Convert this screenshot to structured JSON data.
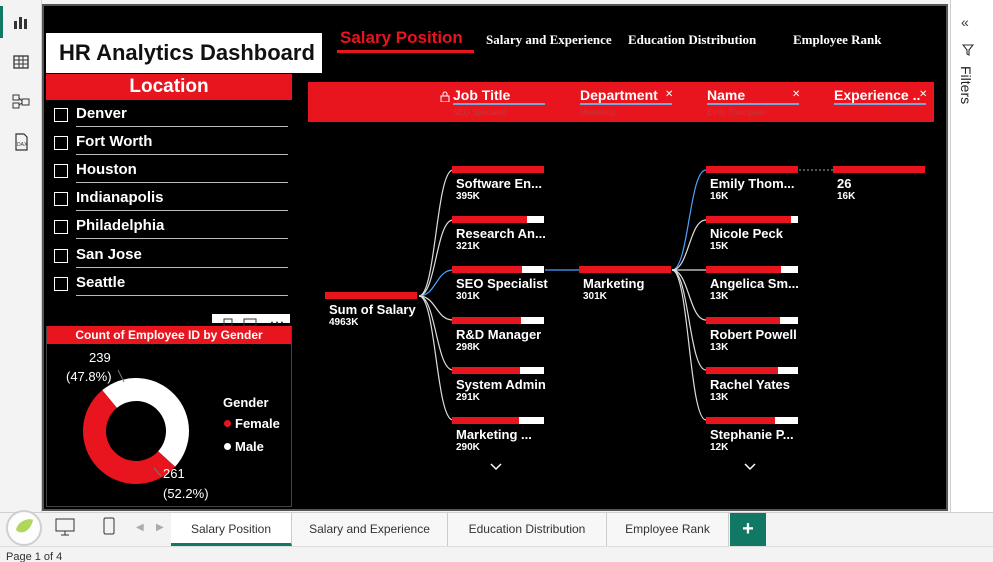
{
  "dashboard": {
    "title": "HR Analytics Dashboard",
    "nav": {
      "active": "Salary Position",
      "items": [
        "Salary and Experience",
        "Education Distribution",
        "Employee Rank"
      ]
    }
  },
  "location_slicer": {
    "title": "Location",
    "items": [
      "Denver",
      "Fort Worth",
      "Houston",
      "Indianapolis",
      "Philadelphia",
      "San Jose",
      "Seattle"
    ]
  },
  "gender_chart": {
    "title": "Count of Employee ID by Gender",
    "legend_title": "Gender",
    "legend": [
      "Female",
      "Male"
    ],
    "label_male": "239",
    "label_male_pct": "(47.8%)",
    "label_female": "261",
    "label_female_pct": "(52.2%)"
  },
  "chart_data": {
    "type": "pie",
    "title": "Count of Employee ID by Gender",
    "categories": [
      "Female",
      "Male"
    ],
    "values": [
      261,
      239
    ],
    "percentages": [
      52.2,
      47.8
    ],
    "donut": true,
    "legend_placement": "right",
    "colors": {
      "Female": "#e8141e",
      "Male": "#ffffff"
    }
  },
  "tree": {
    "levels": [
      {
        "title": "Job Title",
        "sub": "SEO Specialist",
        "lock": true
      },
      {
        "title": "Department",
        "sub": "Marketing"
      },
      {
        "title": "Name",
        "sub": "Emily Thompson"
      },
      {
        "title": "Experience ...",
        "sub": ""
      }
    ],
    "root": {
      "label": "Sum of Salary",
      "value": "4963K"
    },
    "job_titles": [
      {
        "label": "Software En...",
        "value": "395K",
        "fill": 1.0
      },
      {
        "label": "Research An...",
        "value": "321K",
        "fill": 0.81
      },
      {
        "label": "SEO Specialist",
        "value": "301K",
        "fill": 0.76
      },
      {
        "label": "R&D Manager",
        "value": "298K",
        "fill": 0.75
      },
      {
        "label": "System Admin",
        "value": "291K",
        "fill": 0.74
      },
      {
        "label": "Marketing ...",
        "value": "290K",
        "fill": 0.73
      }
    ],
    "departments": [
      {
        "label": "Marketing",
        "value": "301K",
        "fill": 1.0
      }
    ],
    "names": [
      {
        "label": "Emily Thom...",
        "value": "16K",
        "fill": 1.0
      },
      {
        "label": "Nicole Peck",
        "value": "15K",
        "fill": 0.92
      },
      {
        "label": "Angelica Sm...",
        "value": "13K",
        "fill": 0.81
      },
      {
        "label": "Robert Powell",
        "value": "13K",
        "fill": 0.8
      },
      {
        "label": "Rachel Yates",
        "value": "13K",
        "fill": 0.78
      },
      {
        "label": "Stephanie P...",
        "value": "12K",
        "fill": 0.75
      }
    ],
    "experience": [
      {
        "label": "26",
        "value": "16K",
        "fill": 1.0
      }
    ]
  },
  "filters_pane": {
    "label": "Filters"
  },
  "pages": {
    "tabs": [
      "Salary Position",
      "Salary and Experience",
      "Education Distribution",
      "Employee Rank"
    ],
    "active": "Salary Position",
    "add_label": "+"
  },
  "status": {
    "page": "Page 1 of 4"
  },
  "colors": {
    "accent": "#e8141e",
    "brand": "#117865",
    "canvas": "#000000"
  }
}
